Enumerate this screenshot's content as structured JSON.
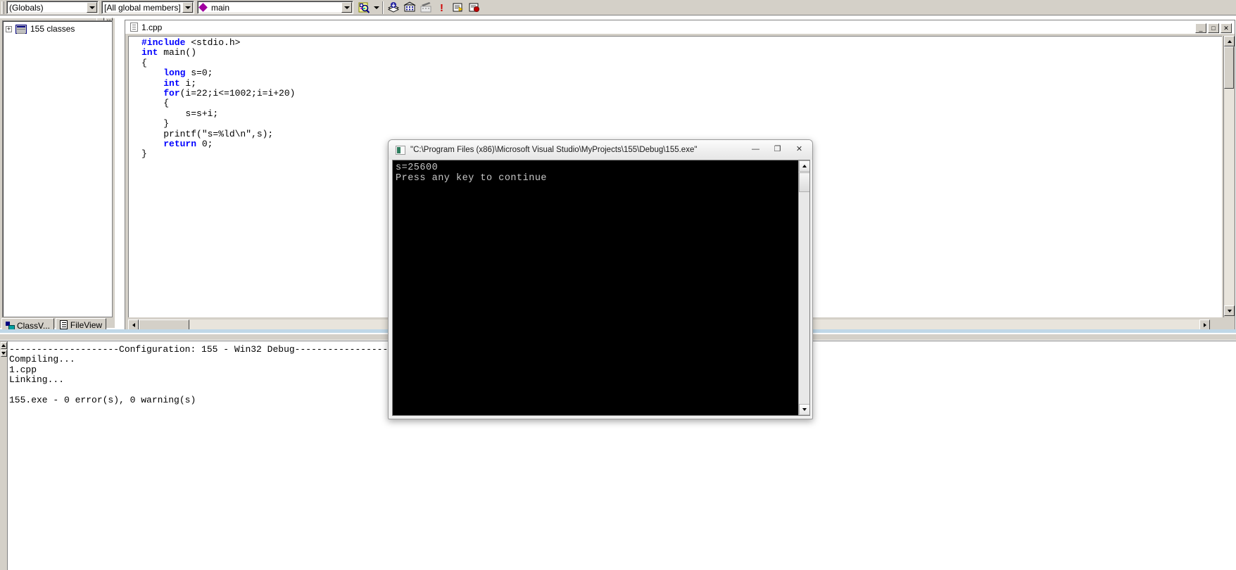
{
  "toolbar": {
    "combo_globals": "(Globals)",
    "combo_members": "[All global members]",
    "combo_function": "main",
    "icons": [
      "find-in-files-icon",
      "compile-icon",
      "build-icon",
      "stop-build-icon",
      "execute-program-icon",
      "go-debug-icon",
      "insert-breakpoint-icon"
    ]
  },
  "workspace": {
    "tree_root_label": "155 classes",
    "expander": "+",
    "tabs": [
      {
        "label": "ClassV...",
        "icon": "classview-icon",
        "active": true
      },
      {
        "label": "FileView",
        "icon": "fileview-icon",
        "active": false
      }
    ]
  },
  "editor": {
    "tab_title": "1.cpp",
    "window_buttons": [
      "_",
      "□",
      "✕"
    ],
    "code_lines": [
      [
        {
          "t": "#include",
          "c": "pp"
        },
        {
          "t": " <stdio.h>",
          "c": ""
        }
      ],
      [
        {
          "t": "int",
          "c": "kw"
        },
        {
          "t": " main()",
          "c": ""
        }
      ],
      [
        {
          "t": "{",
          "c": ""
        }
      ],
      [
        {
          "t": "    ",
          "c": ""
        },
        {
          "t": "long",
          "c": "kw"
        },
        {
          "t": " s=0;",
          "c": ""
        }
      ],
      [
        {
          "t": "    ",
          "c": ""
        },
        {
          "t": "int",
          "c": "kw"
        },
        {
          "t": " i;",
          "c": ""
        }
      ],
      [
        {
          "t": "    ",
          "c": ""
        },
        {
          "t": "for",
          "c": "kw"
        },
        {
          "t": "(i=22;i<=1002;i=i+20)",
          "c": ""
        }
      ],
      [
        {
          "t": "    {",
          "c": ""
        }
      ],
      [
        {
          "t": "        s=s+i;",
          "c": ""
        }
      ],
      [
        {
          "t": "    }",
          "c": ""
        }
      ],
      [
        {
          "t": "    printf(\"s=%ld\\n\",s);",
          "c": ""
        }
      ],
      [
        {
          "t": "    ",
          "c": ""
        },
        {
          "t": "return",
          "c": "kw"
        },
        {
          "t": " 0;",
          "c": ""
        }
      ],
      [
        {
          "t": "}",
          "c": ""
        }
      ]
    ]
  },
  "console": {
    "title": "\"C:\\Program Files (x86)\\Microsoft Visual Studio\\MyProjects\\155\\Debug\\155.exe\"",
    "buttons": [
      "—",
      "❐",
      "✕"
    ],
    "output": "s=25600\nPress any key to continue"
  },
  "build_output": {
    "lines": [
      "--------------------Configuration: 155 - Win32 Debug--------------------",
      "Compiling...",
      "1.cpp",
      "Linking...",
      "",
      "155.exe - 0 error(s), 0 warning(s)"
    ]
  },
  "colors": {
    "keyword": "#0000ff",
    "face": "#d4d0c8",
    "console_bg": "#000000",
    "console_fg": "#c8c8c8",
    "function_marker": "#a000a0"
  }
}
